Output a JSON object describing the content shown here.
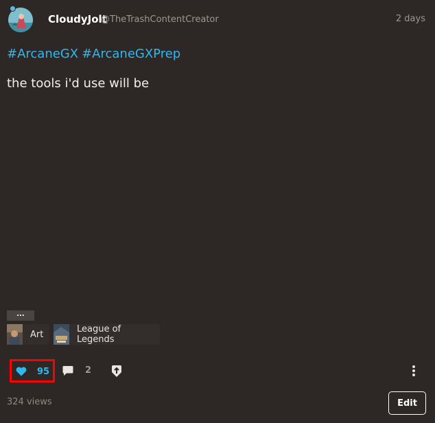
{
  "post": {
    "author_name": "CloudyJolt",
    "author_handle": "@TheTrashContentCreator",
    "time": "2 days",
    "hashtags": [
      "#ArcaneGX",
      "#ArcaneGXPrep"
    ],
    "body": "the tools i'd use will be"
  },
  "expand_label": "...",
  "communities": [
    {
      "label": "Art",
      "icon": "art-community-thumbnail"
    },
    {
      "label": "League of Legends",
      "icon": "league-of-legends-community-thumbnail"
    }
  ],
  "actions": {
    "like_count": "95",
    "comment_count": "2",
    "like_icon": "heart-icon",
    "comment_icon": "comment-icon",
    "share_icon": "share-icon",
    "menu_icon": "vertical-dots-icon"
  },
  "footer": {
    "views": "324 views",
    "edit_label": "Edit"
  },
  "colors": {
    "background": "#2d2825",
    "accent": "#2fb8f0",
    "highlight_box": "#ff0000",
    "muted_text": "#9c9792"
  }
}
